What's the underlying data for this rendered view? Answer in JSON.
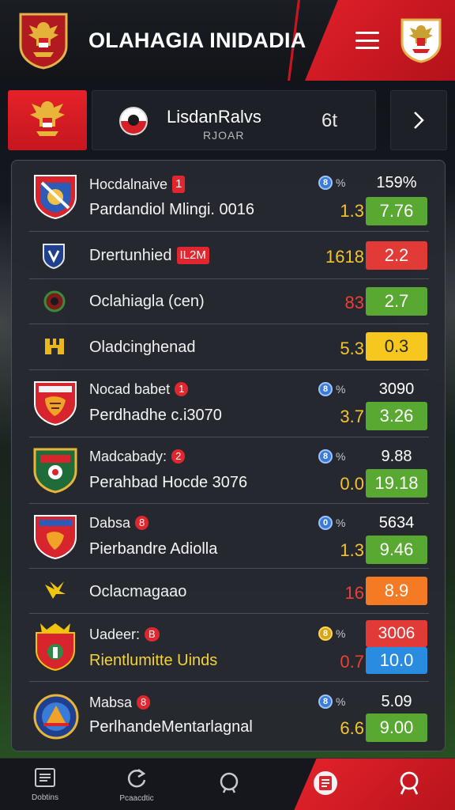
{
  "header": {
    "title": "OLAHAGIA INIDADIA",
    "menu_icon": "hamburger-menu-icon",
    "logo_icon": "garuda-crest-icon",
    "right_crest_icon": "club-shield-icon"
  },
  "match": {
    "title": "LisdanRalvs",
    "subtitle": "RJOAR",
    "score": "6t",
    "next_icon": "chevron-right-icon"
  },
  "teams": [
    {
      "name": "Hocdalnaive",
      "badge": "1",
      "detail": "Pardandiol Mlingi. 0016",
      "pct_icon": "8",
      "pct": "%",
      "odd": "1.3",
      "odd_color": "#f4c430",
      "stat": "159%",
      "box": "7.76",
      "box_color": "#58a832",
      "logo": "shield-red-blue-icon"
    },
    {
      "name": "Drertunhied",
      "badge": "IL2M",
      "odd": "1618",
      "odd_color": "#f4c430",
      "box": "2.2",
      "box_color": "#e23a37",
      "logo": "shield-blue-icon"
    },
    {
      "name": "Oclahiagla (cen)",
      "odd": "83",
      "odd_color": "#ea4036",
      "box": "2.7",
      "box_color": "#58a832",
      "logo": "round-red-icon"
    },
    {
      "name": "Oladcinghenad",
      "odd": "5.3",
      "odd_color": "#f4c430",
      "box": "0.3",
      "box_color": "#f6c71e",
      "logo": "shield-yellow-icon"
    },
    {
      "name": "Nocad babet",
      "badge": "1",
      "detail": "Perdhadhe c.i3070",
      "pct_icon": "8",
      "pct": "%",
      "odd": "3.7",
      "odd_color": "#f4c430",
      "stat": "3090",
      "box": "3.26",
      "box_color": "#58a832",
      "logo": "shield-tiger-icon"
    },
    {
      "name": "Madcabady:",
      "badge": "2",
      "detail": "Perahbad Hocde 3076",
      "pct_icon": "8",
      "pct": "%",
      "odd": "0.0",
      "odd_color": "#f4c430",
      "stat": "9.88",
      "box": "19.18",
      "box_color": "#58a832",
      "logo": "shield-green-icon"
    },
    {
      "name": "Dabsa",
      "badge": "8",
      "detail": "Pierbandre Adiolla",
      "pct_icon": "0",
      "pct": "%",
      "odd": "1.3",
      "odd_color": "#f4c430",
      "stat": "5634",
      "box": "9.46",
      "box_color": "#58a832",
      "logo": "shield-eagle-icon"
    },
    {
      "name": "Oclacmagaao",
      "odd": "16",
      "odd_color": "#ea4036",
      "box": "8.9",
      "box_color": "#f47b24",
      "logo": "wings-yellow-icon"
    },
    {
      "name": "Uadeer:",
      "badge": "B",
      "detail": "Rientlumitte Uinds",
      "pct_icon": "8",
      "pct": "%",
      "odd": "0.7",
      "odd_color": "#ea4036",
      "stat_box": "3006",
      "box": "10.0",
      "box_color": "#2a8ce0",
      "logo": "shield-crown-icon"
    },
    {
      "name": "Mabsa",
      "badge": "8",
      "detail": "PerlhandeMentarlagnal",
      "pct_icon": "8",
      "pct": "%",
      "odd": "6.6",
      "odd_color": "#f4c430",
      "stat": "5.09",
      "box": "9.00",
      "box_color": "#58a832",
      "logo": "round-blue-icon"
    }
  ],
  "nav": {
    "home_label": "Dobtins",
    "refresh_label": "Pcaacdtic",
    "home_icon": "list-icon",
    "refresh_icon": "refresh-icon",
    "search_icon": "search-icon",
    "card_icon": "ticket-icon",
    "user_icon": "search-user-icon"
  }
}
